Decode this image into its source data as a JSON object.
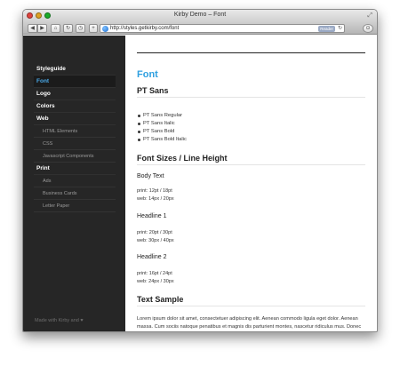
{
  "window": {
    "title": "Kirby Demo – Font"
  },
  "toolbar": {
    "url": "http://styles.getkirby.com/font",
    "reader_label": "Reader"
  },
  "sidebar": {
    "items": [
      {
        "label": "Styleguide",
        "kind": "section"
      },
      {
        "label": "Font",
        "kind": "active"
      },
      {
        "label": "Logo",
        "kind": "section"
      },
      {
        "label": "Colors",
        "kind": "section"
      },
      {
        "label": "Web",
        "kind": "section"
      },
      {
        "label": "HTML Elements",
        "kind": "sub"
      },
      {
        "label": "CSS",
        "kind": "sub"
      },
      {
        "label": "Javascript Components",
        "kind": "sub"
      },
      {
        "label": "Print",
        "kind": "section"
      },
      {
        "label": "Ads",
        "kind": "sub"
      },
      {
        "label": "Business Cards",
        "kind": "sub"
      },
      {
        "label": "Letter Paper",
        "kind": "sub"
      }
    ],
    "footer": "Made with Kirby and ♥"
  },
  "content": {
    "title": "Font",
    "pt_sans_heading": "PT Sans",
    "font_list": [
      "PT Sans Regular",
      "PT Sans Italic",
      "PT Sans Bold",
      "PT Sans Bold Italic"
    ],
    "sizes_heading": "Font Sizes / Line Height",
    "body_text_heading": "Body Text",
    "body_text_print": "print: 12pt / 18pt",
    "body_text_web": "web: 14px / 20px",
    "headline1_heading": "Headline 1",
    "headline1_print": "print: 20pt / 30pt",
    "headline1_web": "web: 30px / 40px",
    "headline2_heading": "Headline 2",
    "headline2_print": "print: 16pt / 24pt",
    "headline2_web": "web: 24px / 30px",
    "sample_heading": "Text Sample",
    "sample_text": "Lorem ipsum dolor sit amet, consectetuer adipiscing elit. Aenean commodo ligula eget dolor. Aenean massa. Cum sociis natoque penatibus et magnis dis parturient montes, nascetur ridiculus mus. Donec quam felis, ultricies nec, pellentesque eu, pretium quis,"
  }
}
